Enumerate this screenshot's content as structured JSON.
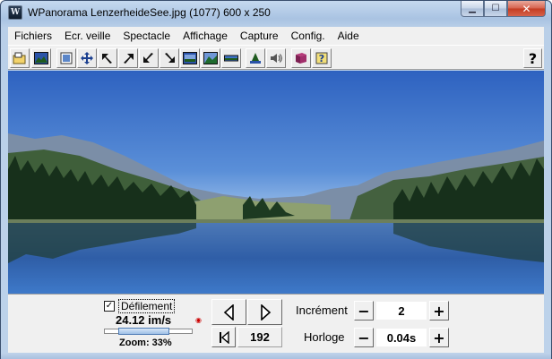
{
  "window": {
    "app_name": "WPanorama",
    "title": "WPanorama  LenzerheideSee.jpg  (1077) 600 x 250",
    "app_icon_glyph": "W"
  },
  "caption_buttons": {
    "minimize": "▁",
    "maximize": "☐",
    "close": "✕"
  },
  "menu": {
    "items": [
      "Fichiers",
      "Ecr. veille",
      "Spectacle",
      "Affichage",
      "Capture",
      "Config.",
      "Aide"
    ]
  },
  "toolbar": {
    "buttons": [
      "open-file-icon",
      "picture-icon",
      "screen-icon",
      "move-icon",
      "arrow-up-left-icon",
      "arrow-up-right-icon",
      "arrow-down-left-icon",
      "arrow-down-right-icon",
      "fit-height-icon",
      "fit-width-icon",
      "strip-icon",
      "bell-icon",
      "sound-icon",
      "book-icon",
      "help-icon"
    ],
    "help_label": "?"
  },
  "panorama": {
    "filename": "LenzerheideSee.jpg"
  },
  "controls": {
    "scroll_checked": true,
    "scroll_label": "Défilement",
    "speed": "24.12 im/s",
    "zoom": "Zoom: 33%",
    "zoom_fraction": 0.33,
    "position": "192",
    "increment_label": "Incrément",
    "increment_value": "2",
    "clock_label": "Horloge",
    "clock_value": "0.04s",
    "minus": "−",
    "plus": "+"
  },
  "colors": {
    "sky": "#3d76cc",
    "lake": "#2a5aa0",
    "forest": "#1f3a22",
    "title_gradient": "#bdd2ea",
    "close_red": "#c43c22"
  }
}
